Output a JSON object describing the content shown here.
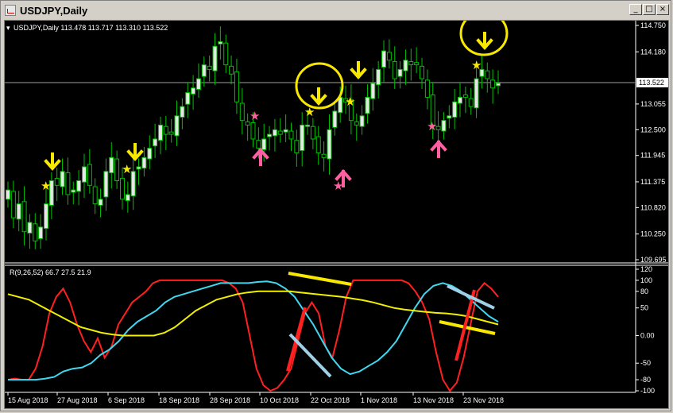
{
  "window": {
    "title": "USDJPY,Daily",
    "buttons": {
      "minimize": "_",
      "maximize": "□",
      "close": "×"
    }
  },
  "chart": {
    "header": "USDJPY,Daily  113.478 113.717 113.310 113.522",
    "price_ticks": [
      "114.750",
      "114.180",
      "113.522",
      "113.055",
      "112.500",
      "111.945",
      "111.375",
      "110.820",
      "110.250",
      "109.695"
    ],
    "current_price": "113.522",
    "date_ticks": [
      "15 Aug 2018",
      "27 Aug 2018",
      "6 Sep 2018",
      "18 Sep 2018",
      "28 Sep 2018",
      "10 Oct 2018",
      "22 Oct 2018",
      "1 Nov 2018",
      "13 Nov 2018",
      "23 Nov 2018"
    ]
  },
  "indicator": {
    "header": "R(9,26,52) 66.7 27.5 21.9",
    "ticks": [
      "120",
      "100",
      "80",
      "50",
      "0.00",
      "-50",
      "-80",
      "-100"
    ]
  },
  "colors": {
    "bull": "#e6e6e6",
    "bear": "#000000",
    "wick": "#00c000",
    "r9": "#ff2020",
    "r26": "#40d8f0",
    "r52": "#f0f000",
    "annotation_yellow": "#f8e800",
    "annotation_pink": "#ff5fa0",
    "annotation_lightblue": "#a0d0e8"
  },
  "chart_data": {
    "type": "candlestick",
    "symbol": "USDJPY",
    "timeframe": "Daily",
    "last_ohlc": {
      "open": 113.478,
      "high": 113.717,
      "low": 113.31,
      "close": 113.522
    },
    "ylim": [
      109.695,
      114.75
    ],
    "indicator_ylim": [
      -100,
      120
    ],
    "candles_close": [
      111.2,
      110.6,
      110.9,
      110.3,
      110.5,
      110.1,
      110.4,
      110.9,
      111.4,
      111.3,
      111.6,
      111.1,
      111.2,
      111.4,
      111.7,
      111.3,
      110.9,
      111.0,
      111.6,
      111.9,
      111.4,
      111.0,
      111.1,
      111.6,
      111.7,
      111.9,
      112.1,
      112.3,
      112.6,
      112.4,
      112.4,
      112.8,
      113.0,
      113.3,
      113.4,
      113.6,
      113.9,
      113.8,
      114.3,
      114.4,
      113.9,
      113.7,
      113.1,
      112.7,
      112.6,
      112.3,
      112.1,
      112.3,
      112.4,
      112.5,
      112.4,
      112.5,
      112.3,
      112.0,
      112.6,
      112.6,
      112.3,
      112.0,
      111.9,
      112.5,
      112.9,
      113.2,
      113.1,
      112.7,
      112.6,
      112.8,
      113.2,
      113.5,
      113.8,
      114.2,
      114.0,
      113.6,
      113.8,
      114.0,
      113.9,
      113.9,
      113.6,
      113.2,
      112.6,
      112.5,
      112.7,
      112.8,
      113.1,
      113.2,
      113.2,
      113.0,
      113.6,
      113.8,
      113.6,
      113.4,
      113.5
    ],
    "series": [
      {
        "name": "R(9)",
        "values": [
          -80,
          -78,
          -80,
          -80,
          -60,
          -20,
          40,
          70,
          85,
          60,
          20,
          -10,
          -30,
          -5,
          -40,
          -20,
          20,
          40,
          60,
          70,
          80,
          95,
          100,
          100,
          100,
          100,
          100,
          100,
          100,
          100,
          100,
          100,
          95,
          85,
          60,
          0,
          -60,
          -90,
          -100,
          -95,
          -80,
          -60,
          -10,
          40,
          60,
          40,
          -20,
          -40,
          10,
          70,
          100,
          100,
          100,
          100,
          100,
          100,
          100,
          100,
          95,
          80,
          60,
          30,
          -30,
          -80,
          -100,
          -85,
          -40,
          20,
          80,
          95,
          85,
          70
        ]
      },
      {
        "name": "R(26)",
        "values": [
          -80,
          -80,
          -80,
          -80,
          -78,
          -75,
          -65,
          -60,
          -58,
          -50,
          -35,
          -25,
          -10,
          10,
          25,
          35,
          45,
          60,
          70,
          75,
          80,
          85,
          90,
          95,
          95,
          95,
          95,
          97,
          98,
          95,
          85,
          70,
          45,
          20,
          -10,
          -40,
          -60,
          -70,
          -65,
          -55,
          -45,
          -30,
          -10,
          20,
          50,
          75,
          90,
          95,
          90,
          80,
          65,
          50,
          35,
          25
        ]
      },
      {
        "name": "R(52)",
        "values": [
          75,
          70,
          65,
          55,
          45,
          35,
          25,
          15,
          10,
          5,
          2,
          0,
          0,
          0,
          0,
          5,
          15,
          30,
          45,
          55,
          65,
          70,
          75,
          78,
          80,
          80,
          80,
          80,
          78,
          76,
          74,
          72,
          70,
          67,
          64,
          60,
          55,
          50,
          47,
          45,
          43,
          41,
          40,
          38,
          35,
          30,
          25,
          20
        ]
      }
    ]
  }
}
